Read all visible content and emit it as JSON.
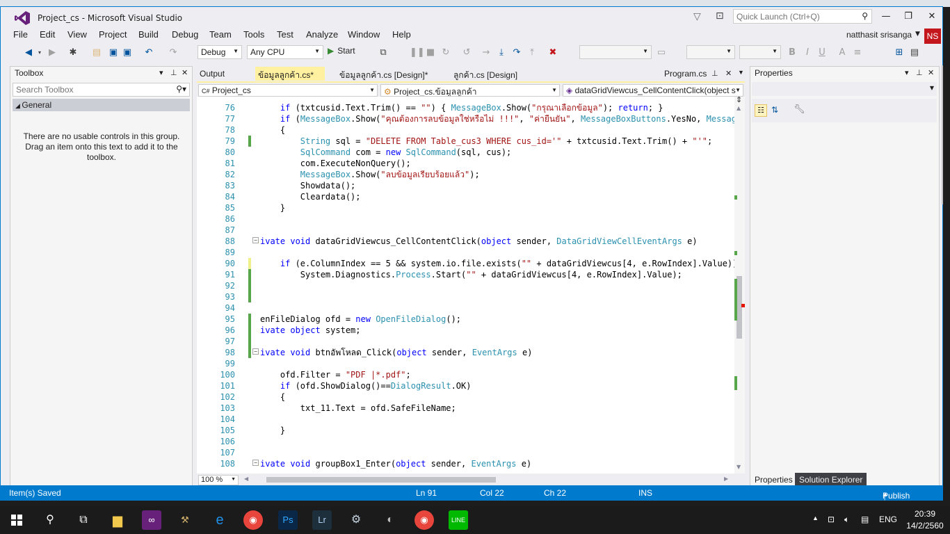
{
  "app": {
    "title": "Project_cs - Microsoft Visual Studio",
    "quick_launch_placeholder": "Quick Launch (Ctrl+Q)"
  },
  "menu": [
    "File",
    "Edit",
    "View",
    "Project",
    "Build",
    "Debug",
    "Team",
    "Tools",
    "Test",
    "Analyze",
    "Window",
    "Help"
  ],
  "user": {
    "name": "natthasit srisanga",
    "initials": "NS"
  },
  "toolbar": {
    "config": "Debug",
    "platform": "Any CPU",
    "start_label": "Start"
  },
  "toolbox": {
    "title": "Toolbox",
    "search_placeholder": "Search Toolbox",
    "group": "General",
    "empty_text": "There are no usable controls in this group. Drag an item onto this text to add it to the toolbox."
  },
  "tabs": {
    "output": "Output",
    "active": "ข้อมูลลูกค้า.cs*",
    "design1": "ข้อมูลลูกค้า.cs [Design]*",
    "design2": "ลูกค้า.cs [Design]",
    "program": "Program.cs"
  },
  "navbar": {
    "project": "Project_cs",
    "class": "Project_cs.ข้อมูลลูกค้า",
    "member": "dataGridViewcus_CellContentClick(object s"
  },
  "zoom": "100 %",
  "properties": {
    "title": "Properties",
    "tab_properties": "Properties",
    "tab_solution": "Solution Explorer"
  },
  "status": {
    "message": "Item(s) Saved",
    "ln": "Ln 91",
    "col": "Col 22",
    "ch": "Ch 22",
    "mode": "INS",
    "publish": "Publish"
  },
  "taskbar": {
    "lang": "ENG",
    "time": "20:39",
    "date": "14/2/2560"
  }
}
